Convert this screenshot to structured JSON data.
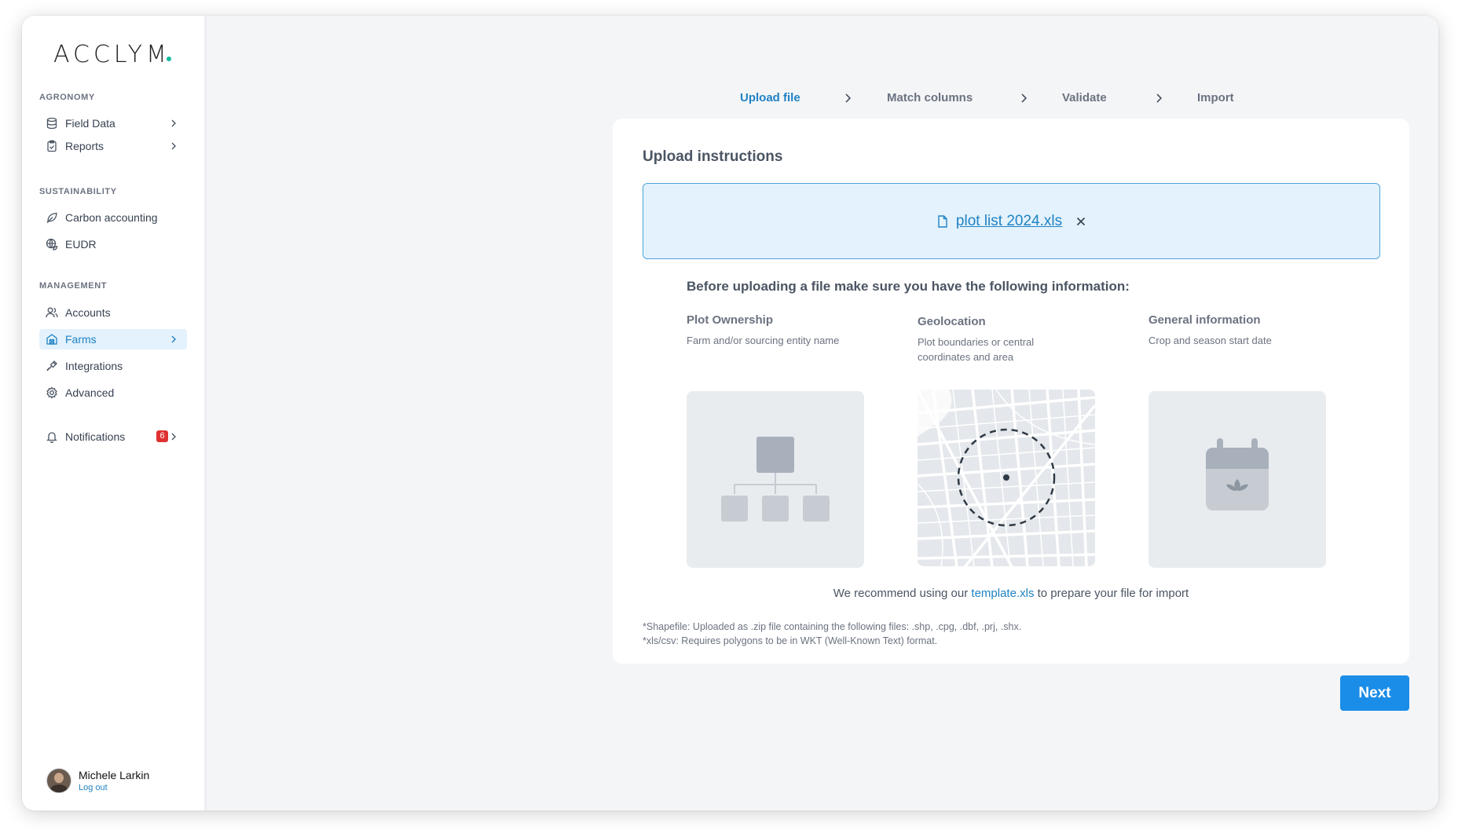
{
  "brand": {
    "name": "ACCLYM"
  },
  "sidebar": {
    "sections": [
      {
        "title": "AGRONOMY"
      },
      {
        "title": "SUSTAINABILITY"
      },
      {
        "title": "MANAGEMENT"
      }
    ],
    "items": [
      {
        "label": "Field Data"
      },
      {
        "label": "Reports"
      },
      {
        "label": "Carbon accounting"
      },
      {
        "label": "EUDR"
      },
      {
        "label": "Accounts"
      },
      {
        "label": "Farms"
      },
      {
        "label": "Integrations"
      },
      {
        "label": "Advanced"
      },
      {
        "label": "Notifications",
        "badge": "6"
      }
    ],
    "active_item": "Farms",
    "user": {
      "name": "Michele Larkin",
      "logout": "Log out"
    }
  },
  "stepper": {
    "steps": [
      {
        "label": "Upload file",
        "active": true
      },
      {
        "label": "Match columns",
        "active": false
      },
      {
        "label": "Validate",
        "active": false
      },
      {
        "label": "Import",
        "active": false
      }
    ]
  },
  "card": {
    "title": "Upload instructions",
    "file_name": "plot list 2024.xls",
    "info_heading": "Before uploading a file make sure you have the following information:",
    "columns": [
      {
        "title": "Plot Ownership",
        "desc": "Farm and/or sourcing entity name",
        "icon": "hierarchy-icon"
      },
      {
        "title": "Geolocation",
        "desc": "Plot boundaries or central coordinates and area",
        "icon": "map-icon"
      },
      {
        "title": "General information",
        "desc": "Crop and season start date",
        "icon": "calendar-icon"
      }
    ],
    "recommend": {
      "prefix": "We recommend using our",
      "link": "template.xls",
      "suffix": "to prepare your file for import"
    },
    "notes": [
      "*Shapefile: Uploaded as .zip file containing the following files: .shp, .cpg, .dbf, .prj, .shx.",
      "*xls/csv: Requires polygons to be in WKT (Well-Known Text) format."
    ]
  },
  "actions": {
    "next": "Next"
  },
  "colors": {
    "accent": "#1a8de8",
    "link": "#1f82c3",
    "active_bg": "#e3f2fc",
    "badge": "#e03131"
  }
}
